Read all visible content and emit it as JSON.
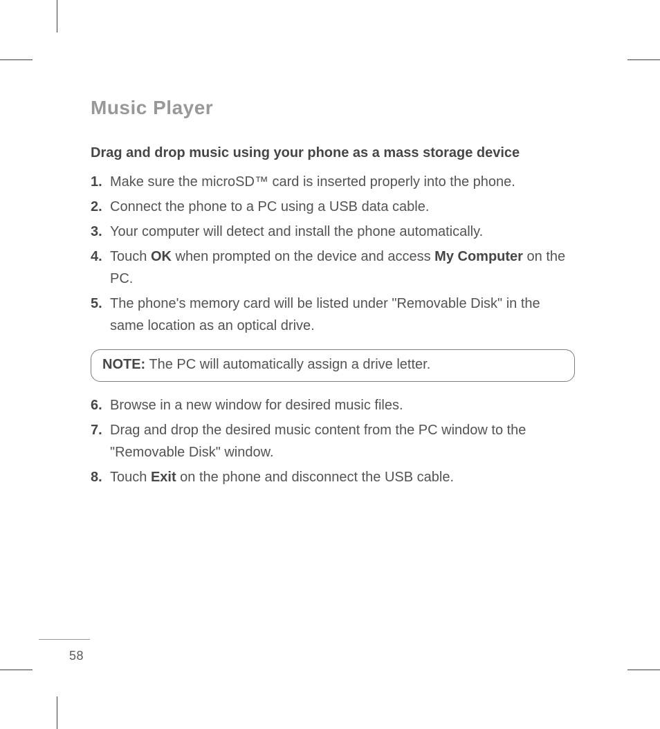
{
  "page": {
    "number": "58",
    "title": "Music Player",
    "subhead": "Drag and drop music using your phone as a mass storage device"
  },
  "steps_a": [
    {
      "n": "1.",
      "pre": " Make sure the microSD™ card is inserted properly into the phone."
    },
    {
      "n": "2.",
      "pre": "Connect the phone to a PC using a USB data cable."
    },
    {
      "n": "3.",
      "pre": "Your computer will detect and install the phone automatically."
    }
  ],
  "step4": {
    "n": "4.",
    "t1": "Touch ",
    "b1": "OK",
    "t2": " when prompted on the device and access ",
    "b2": "My Computer",
    "t3": " on the PC."
  },
  "step5": {
    "n": "5.",
    "t": "The phone's memory card will be listed under \"Removable Disk\" in the same location as an optical drive."
  },
  "note": {
    "label": "NOTE:",
    "body": " The PC will automatically assign a drive letter."
  },
  "steps_b": [
    {
      "n": "6.",
      "pre": "Browse in a new window for desired music files."
    },
    {
      "n": "7.",
      "pre": "Drag and drop the desired music content from the PC window to the \"Removable Disk\" window."
    }
  ],
  "step8": {
    "n": "8.",
    "t1": "Touch ",
    "b1": "Exit",
    "t2": " on the phone and disconnect the USB cable."
  }
}
